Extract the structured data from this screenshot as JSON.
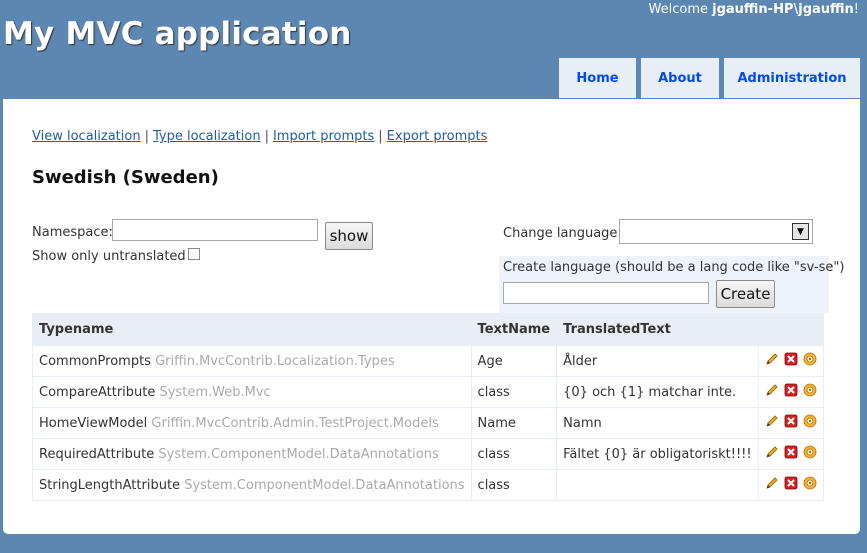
{
  "header": {
    "welcome_prefix": "Welcome ",
    "welcome_user": "jgauffin-HP\\jgauffin",
    "welcome_suffix": "!",
    "app_title": "My MVC application"
  },
  "menu": {
    "tabs": [
      {
        "label": "Home"
      },
      {
        "label": "About"
      },
      {
        "label": "Administration"
      }
    ]
  },
  "subnav": {
    "links": [
      "View localization",
      "Type localization",
      "Import prompts",
      "Export prompts"
    ],
    "separator": "|"
  },
  "language_title": "Swedish (Sweden)",
  "filter": {
    "namespace_label": "Namespace:",
    "namespace_value": "",
    "show_button": "show",
    "untranslated_label": "Show only untranslated",
    "untranslated_checked": false
  },
  "change_language": {
    "label": "Change language:",
    "selected": ""
  },
  "create_language": {
    "label": "Create language (should be a lang code like \"sv-se\")",
    "value": "",
    "button": "Create"
  },
  "table": {
    "headers": [
      "Typename",
      "TextName",
      "TranslatedText"
    ],
    "rows": [
      {
        "type": "CommonPrompts",
        "ns": "Griffin.MvcContrib.Localization.Types",
        "name": "Age",
        "text": "Ålder"
      },
      {
        "type": "CompareAttribute",
        "ns": "System.Web.Mvc",
        "name": "class",
        "text": "{0} och {1} matchar inte."
      },
      {
        "type": "HomeViewModel",
        "ns": "Griffin.MvcContrib.Admin.TestProject.Models",
        "name": "Name",
        "text": "Namn"
      },
      {
        "type": "RequiredAttribute",
        "ns": "System.ComponentModel.DataAnnotations",
        "name": "class",
        "text": "Fältet {0} är obligatoriskt!!!!"
      },
      {
        "type": "StringLengthAttribute",
        "ns": "System.ComponentModel.DataAnnotations",
        "name": "class",
        "text": ""
      }
    ],
    "row_actions": [
      "edit-icon",
      "delete-icon",
      "settings-icon"
    ]
  },
  "colors": {
    "background": "#5c87b2",
    "tab_bg": "#e8eef4",
    "tab_text": "#034af3",
    "link": "#1f5da7",
    "namespace_text": "#aaaaaa"
  }
}
